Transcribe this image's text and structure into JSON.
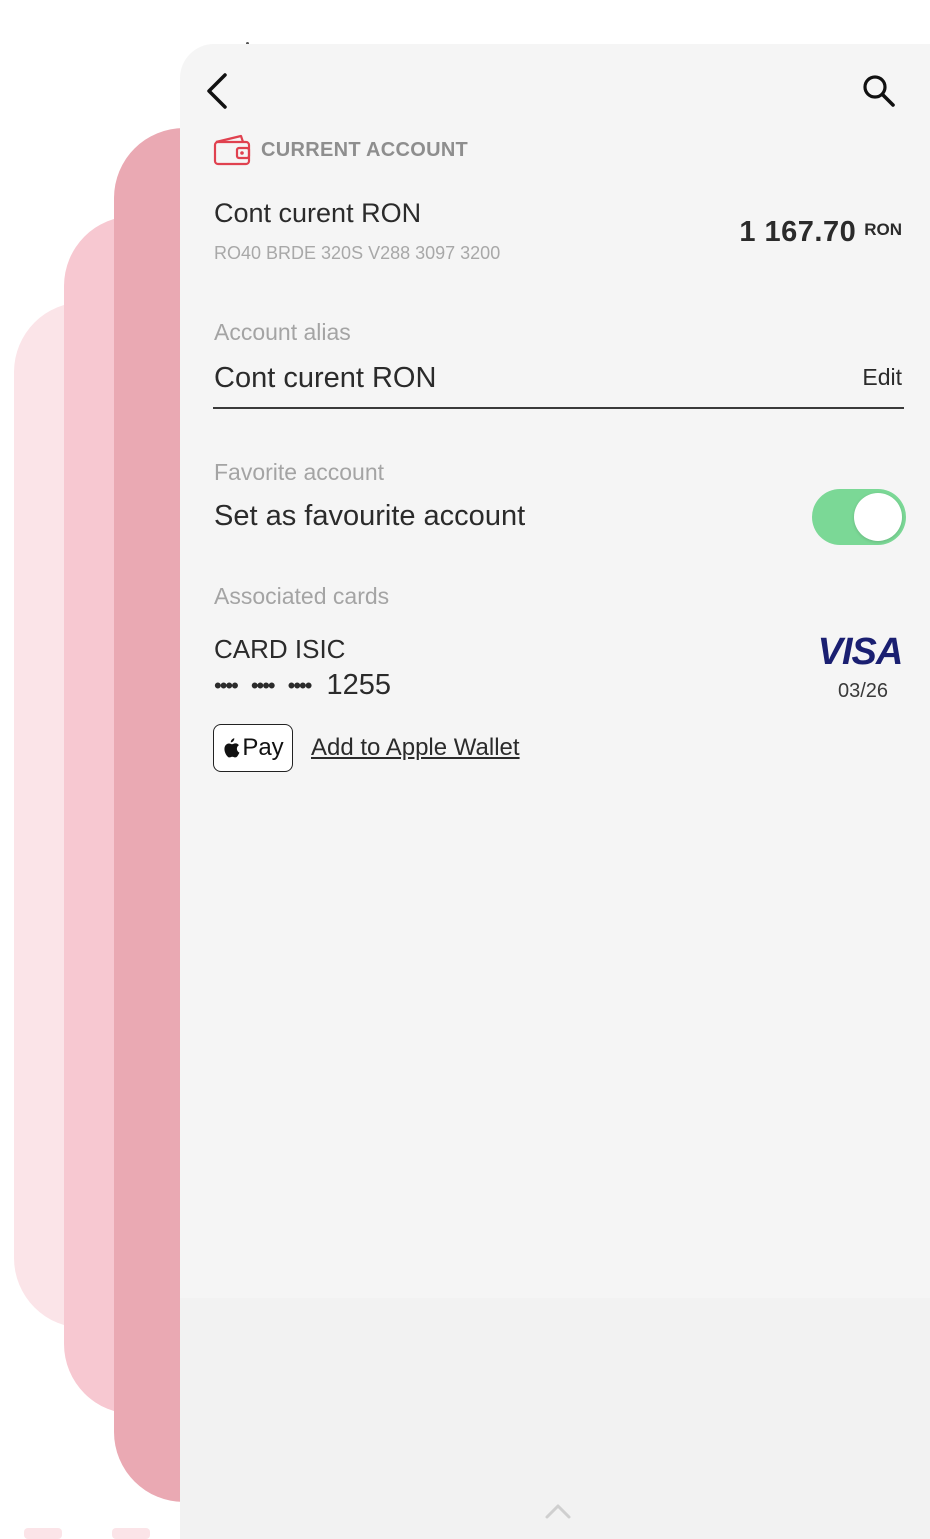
{
  "header": {
    "back_icon": "chevron-left-icon",
    "search_icon": "search-icon"
  },
  "account": {
    "type_icon": "wallet-icon",
    "type_label": "CURRENT ACCOUNT",
    "name": "Cont curent RON",
    "iban": "RO40 BRDE 320S V288 3097 3200",
    "balance": "1 167.70",
    "currency": "RON"
  },
  "alias": {
    "label": "Account alias",
    "value": "Cont curent RON",
    "edit_label": "Edit"
  },
  "favorite": {
    "label": "Favorite account",
    "text": "Set as favourite account",
    "enabled": true
  },
  "cards": {
    "label": "Associated cards",
    "items": [
      {
        "name": "CARD ISIC",
        "masked_groups": [
          "••••",
          "••••",
          "••••"
        ],
        "last4": "1255",
        "brand": "VISA",
        "expiry": "03/26"
      }
    ]
  },
  "wallet": {
    "badge_label": "Pay",
    "link_label": "Add to Apple Wallet"
  },
  "colors": {
    "accent_red": "#e0414f",
    "toggle_on": "#7bd896",
    "visa_blue": "#1a1f71"
  },
  "footer": {
    "expand_icon": "chevron-up-icon"
  }
}
